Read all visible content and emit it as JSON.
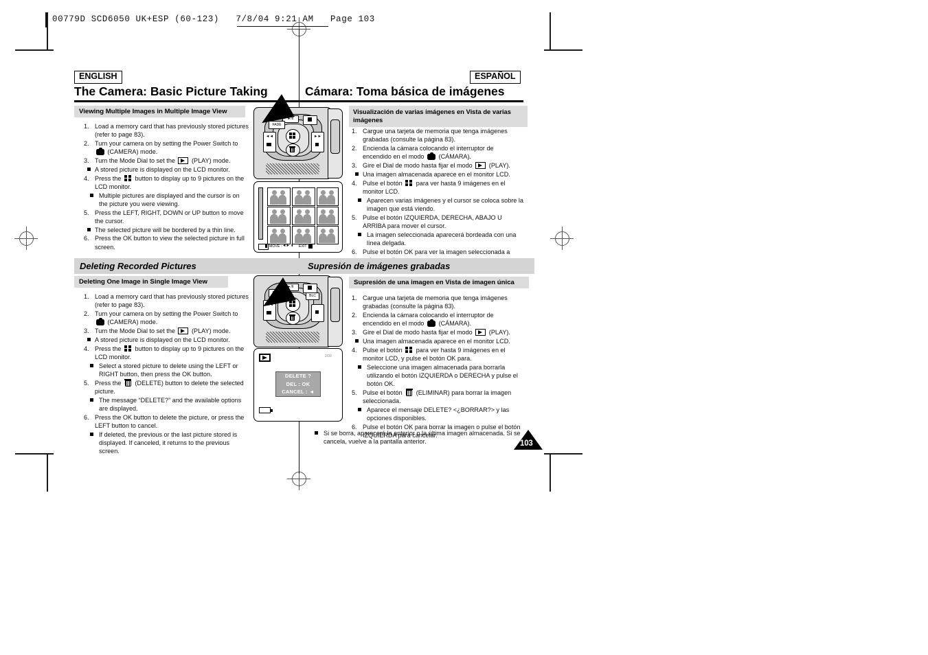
{
  "printer_slug": "00779D SCD6050 UK+ESP (60-123)   7/8/04 9:21 AM   Page 103",
  "page_number": "103",
  "header": {
    "chip_left": "ENGLISH",
    "chip_right": "ESPAÑOL",
    "title_left": "The Camera: Basic Picture Taking",
    "title_right": "Cámara: Toma básica de imágenes"
  },
  "english": {
    "section1_heading": "Viewing Multiple Images in Multiple Image View",
    "section1_steps": [
      {
        "n": "1.",
        "text": "Load a memory card that has previously stored pictures (refer to page 83)."
      },
      {
        "n": "2.",
        "text": "Turn your camera on by setting the Power Switch to",
        "icon": "camera",
        "text2": "(CAMERA) mode."
      },
      {
        "n": "3.",
        "text": "Turn the Mode Dial to set the",
        "icon": "play",
        "text2": "(PLAY) mode.",
        "bullets": [
          "A stored picture is displayed on the LCD monitor."
        ]
      },
      {
        "n": "4.",
        "text": "Press the",
        "icon": "multi",
        "text2": "button to display up to 9 pictures on the LCD monitor.",
        "bullets_indent": [
          "Multiple pictures are displayed and the cursor is on the picture you were viewing."
        ]
      },
      {
        "n": "5.",
        "text": "Press the LEFT, RIGHT, DOWN or UP button to move the cursor.",
        "bullets": [
          "The selected picture will be bordered by a thin line."
        ]
      },
      {
        "n": "6.",
        "text": "Press the OK button to view the selected picture in full screen."
      }
    ],
    "section2_heading": "Deleting Recorded Pictures",
    "section2_subheading": "Deleting One Image in Single Image View",
    "section2_steps": [
      {
        "n": "1.",
        "text": "Load a memory card that has previously stored pictures (refer to page 83)."
      },
      {
        "n": "2.",
        "text": "Turn your camera on by setting the Power Switch to",
        "icon": "camera",
        "text2": "(CAMERA) mode."
      },
      {
        "n": "3.",
        "text": "Turn the Mode Dial to set the",
        "icon": "play",
        "text2": "(PLAY) mode.",
        "bullets": [
          "A stored picture is displayed on the LCD monitor."
        ]
      },
      {
        "n": "4.",
        "text": "Press the",
        "icon": "multi",
        "text2": "button to display up to 9 pictures on the LCD monitor.",
        "bullets_indent": [
          "Select a stored picture to delete using the LEFT or RIGHT button, then press the OK button."
        ]
      },
      {
        "n": "5.",
        "text": "Press the",
        "icon": "trash",
        "text2": "(DELETE) button to delete the selected picture.",
        "bullets_indent": [
          "The message “DELETE?” and the available options are displayed."
        ]
      },
      {
        "n": "6.",
        "text": "Press the OK button to delete the picture, or press the LEFT button to cancel.",
        "bullets_indent": [
          "If deleted, the previous or the last picture stored is displayed. If canceled, it returns to the previous screen."
        ]
      }
    ]
  },
  "spanish": {
    "section1_heading": "Visualización de varias imágenes en Vista de varias imágenes",
    "section1_steps": [
      {
        "n": "1.",
        "text": "Cargue una tarjeta de memoria que tenga imágenes grabadas (consulte la página 83)."
      },
      {
        "n": "2.",
        "text": "Encienda la cámara colocando el interruptor de encendido en el modo",
        "icon": "camera",
        "text2": "(CÁMARA)."
      },
      {
        "n": "3.",
        "text": "Gire el Dial de modo hasta fijar el modo",
        "icon": "play",
        "text2": "(PLAY).",
        "bullets": [
          "Una imagen almacenada aparece en el monitor LCD."
        ]
      },
      {
        "n": "4.",
        "text": "Pulse el botón",
        "icon": "multi",
        "text2": "para ver hasta 9 imágenes en el monitor LCD.",
        "bullets_indent": [
          "Aparecen varias imágenes y el cursor se coloca sobre la imagen que está viendo."
        ]
      },
      {
        "n": "5.",
        "text": "Pulse el botón IZQUIERDA, DERECHA, ABAJO U ARRIBA para mover el cursor.",
        "bullets_indent": [
          "La imagen seleccionada aparecerá bordeada con una línea delgada."
        ]
      },
      {
        "n": "6.",
        "text": "Pulse el botón OK para ver la imagen seleccionada a toda pantalla."
      }
    ],
    "section2_heading": "Supresión de imágenes grabadas",
    "section2_subheading": "Supresión de una imagen en Vista de imagen única",
    "section2_steps": [
      {
        "n": "1.",
        "text": "Cargue una tarjeta de memoria que tenga imágenes grabadas (consulte la página 83)."
      },
      {
        "n": "2.",
        "text": "Encienda la cámara colocando el interruptor de encendido en el modo",
        "icon": "camera",
        "text2": "(CÁMARA)."
      },
      {
        "n": "3.",
        "text": "Gire el Dial de modo hasta fijar el modo",
        "icon": "play",
        "text2": "(PLAY).",
        "bullets": [
          "Una imagen almacenada aparece en el monitor LCD."
        ]
      },
      {
        "n": "4.",
        "text": "Pulse el botón",
        "icon": "multi",
        "text2": "para ver hasta 9 imágenes en el monitor LCD, y pulse el botón OK para.",
        "bullets_indent": [
          "Seleccione una imagen almacenada para borrarla utilizando el botón IZQUIERDA o DERECHA y pulse el botón OK."
        ]
      },
      {
        "n": "5.",
        "text": "Pulse el botón",
        "icon": "trash",
        "text2": "(ELIMINAR) para borrar la imagen seleccionada.",
        "bullets_indent": [
          "Aparece el mensaje DELETE? <¿BORRAR?> y las opciones disponibles."
        ]
      },
      {
        "n": "6.",
        "text": "Pulse el botón OK para borrar la imagen o pulse el botón IZQUIERDA para cancelar."
      }
    ],
    "final_note": "Si se borra, aparecerá la anterior o la última imagen almacenada. Si se cancela, vuelve a la pantalla anterior."
  },
  "figures": {
    "camera_top_1": {
      "buttons": [
        "FADE",
        "►/II",
        "■",
        "◄◄",
        "►►",
        "▬",
        "▫"
      ],
      "highlighted_button": "multi-image-button"
    },
    "camera_top_2": {
      "buttons": [
        "FADE",
        "►/II",
        "■",
        "BLC",
        "◄◄",
        "►►",
        "▬",
        "▫"
      ],
      "highlighted_button": "delete-button"
    },
    "multi_image_lcd": {
      "thumbnail_count": 9,
      "osd_move_label": "MOVE :",
      "osd_exit_label": "EXIT :"
    },
    "delete_lcd": {
      "counter": "2/39",
      "dialog_line1": "DELETE ?",
      "dialog_line2": "DEL : OK",
      "dialog_line3": "CANCEL : ◄"
    }
  }
}
